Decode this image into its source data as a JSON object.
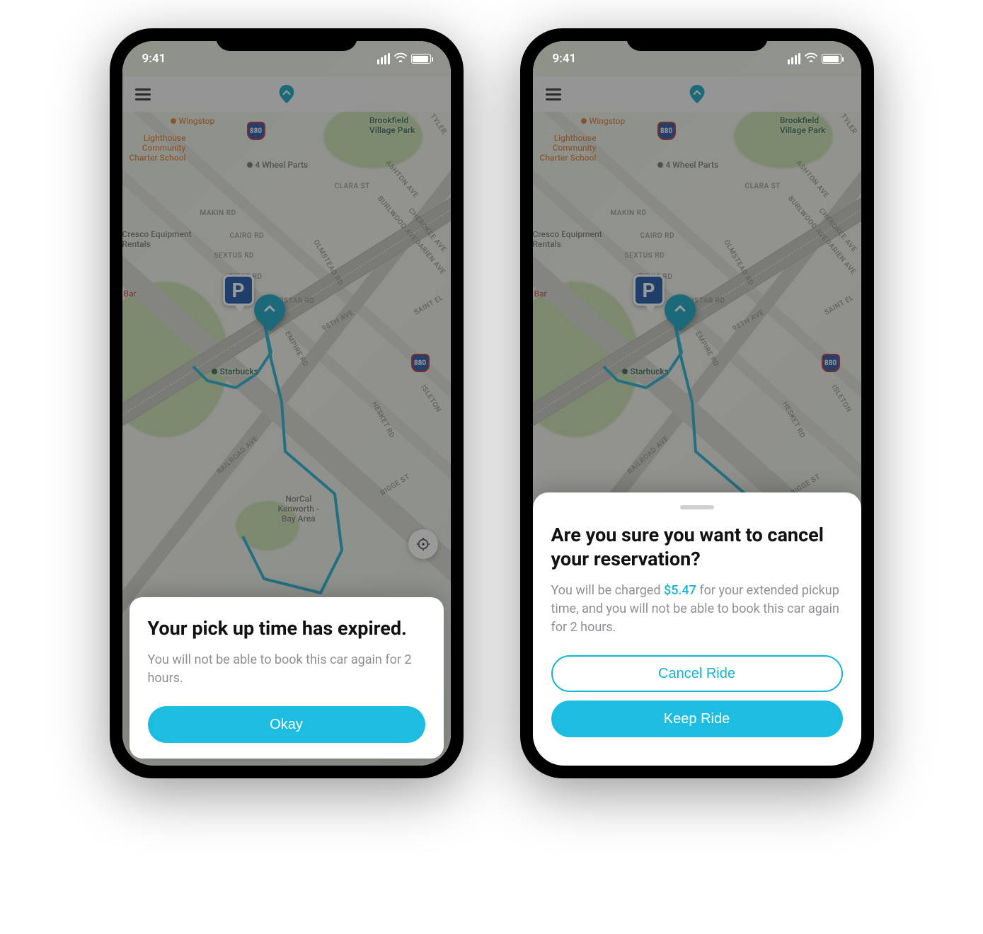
{
  "status": {
    "time": "9:41"
  },
  "map": {
    "pois": {
      "brookfield": "Brookfield\nVillage Park",
      "wingstop": "Wingstop",
      "lighthouse": "Lighthouse\nCommunity\nCharter School",
      "fourwheel": "4 Wheel Parts",
      "cresco": "Cresco Equipment\nRentals",
      "starbucks": "Starbucks",
      "norcal": "NorCal\nKenworth -\nBay Area",
      "bar": "Bar"
    },
    "roads": {
      "clara": "CLARA ST",
      "ashton": "ASHTON AVE",
      "makin": "MAKIN RD",
      "cairo": "CAIRO RD",
      "sextus": "SEXTUS RD",
      "tunis": "TUNIS RD",
      "wistar": "WISTAR RD",
      "ninety8": "98TH AVE",
      "burlwood": "BURLWOOD AVE",
      "cherokee": "CHEROKEE AVE",
      "darien": "DARIEN AVE",
      "saintel": "SAINT EL",
      "hesket": "HESKET RD",
      "bigge": "BIGGE ST",
      "isleton": "ISLETON",
      "tyler": "TYLER",
      "olmstead": "OLMSTEAD RD",
      "empire": "EMPIRE RD",
      "railroad": "RAILROAD AVE"
    },
    "parking_letter": "P",
    "highway_label": "880"
  },
  "sheet_left": {
    "title": "Your pick up time has expired.",
    "body": "You will not be able to book this car again for 2 hours.",
    "button": "Okay"
  },
  "sheet_right": {
    "title": "Are you sure you want to cancel your reservation?",
    "body_pre": "You will be charged ",
    "price": "$5.47",
    "body_post": " for your extended pickup time, and you will not be able to book this car again for 2 hours.",
    "cancel_button": "Cancel Ride",
    "keep_button": "Keep Ride"
  }
}
